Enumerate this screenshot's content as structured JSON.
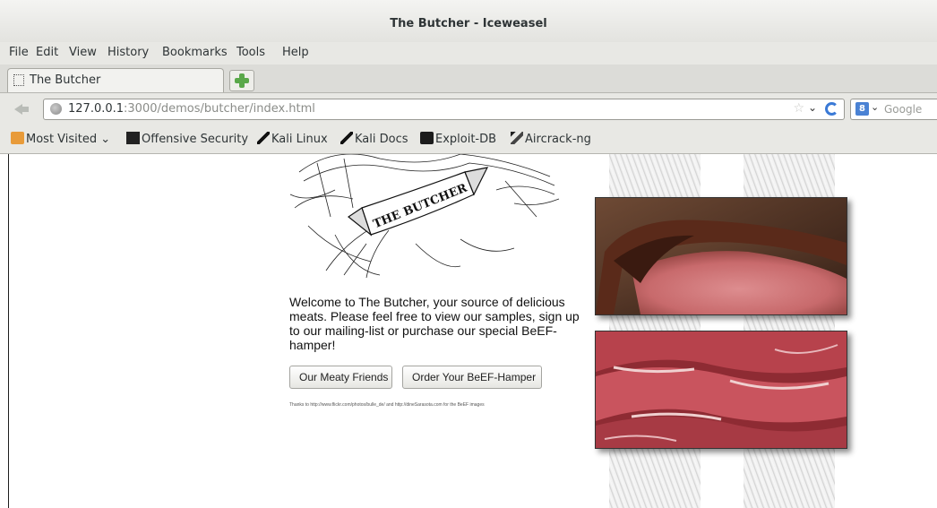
{
  "window": {
    "title": "The Butcher - Iceweasel"
  },
  "menu": [
    "File",
    "Edit",
    "View",
    "History",
    "Bookmarks",
    "Tools",
    "Help"
  ],
  "tab": {
    "label": "The Butcher"
  },
  "address": {
    "host": "127.0.0.1",
    "rest": ":3000/demos/butcher/index.html"
  },
  "search": {
    "placeholder": "Google"
  },
  "bookmarks": [
    {
      "label": "Most Visited",
      "icon": "folder-icon"
    },
    {
      "label": "Offensive Security",
      "icon": "offensive-security-icon"
    },
    {
      "label": "Kali Linux",
      "icon": "kali-dragon-icon"
    },
    {
      "label": "Kali Docs",
      "icon": "kali-dragon-icon"
    },
    {
      "label": "Exploit-DB",
      "icon": "exploit-db-icon"
    },
    {
      "label": "Aircrack-ng",
      "icon": "aircrack-icon"
    }
  ],
  "page": {
    "logo_text": "THE BUTCHER",
    "welcome": "Welcome to The Butcher, your source of delicious meats. Please feel free to view our samples, sign up to our mailing-list or purchase our special BeEF-hamper!",
    "buttons": {
      "friends": "Our Meaty Friends",
      "hamper": "Order Your BeEF-Hamper"
    },
    "thanks": "Thanks to http://www.flickr.com/photos/bulle_de/ and http://dineSarasota.com for the BeEF images"
  },
  "colors": {
    "accent_reload": "#3b7ad6",
    "folder": "#e89b3a",
    "newtab_plus": "#5aa84a"
  }
}
